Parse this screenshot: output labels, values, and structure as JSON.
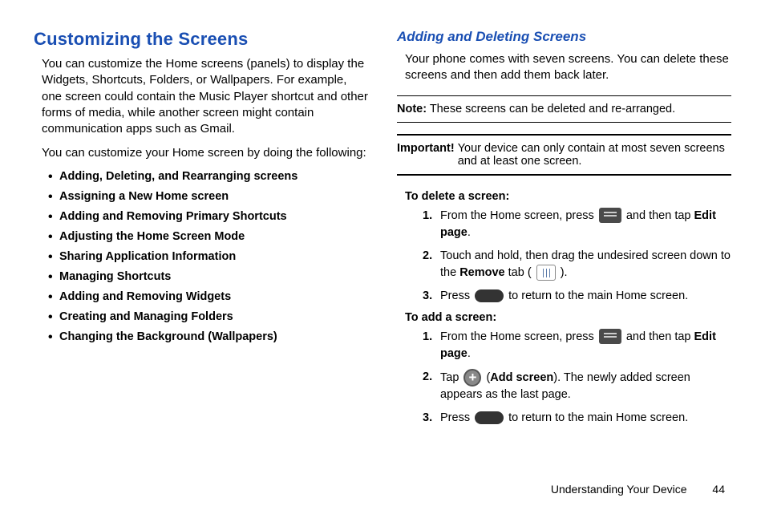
{
  "left": {
    "h1": "Customizing the Screens",
    "p1": "You can customize the Home screens (panels) to display the Widgets, Shortcuts, Folders, or Wallpapers. For example, one screen could contain the Music Player shortcut and other forms of media, while another screen might contain communication apps such as Gmail.",
    "p2": "You can customize your Home screen by doing the following:",
    "bullets": [
      "Adding, Deleting, and Rearranging screens",
      "Assigning a New Home screen",
      "Adding and Removing Primary Shortcuts",
      "Adjusting the Home Screen Mode",
      "Sharing Application Information",
      "Managing Shortcuts",
      "Adding and Removing Widgets",
      "Creating and Managing Folders",
      "Changing the Background (Wallpapers)"
    ]
  },
  "right": {
    "h2": "Adding and Deleting Screens",
    "p1": "Your phone comes with seven screens. You can delete these screens and then add them back later.",
    "note_label": "Note:",
    "note_text": " These screens can be deleted and re-arranged.",
    "important_label": "Important!",
    "important_text": " Your device can only contain at most seven screens and at least one screen.",
    "delete_h": "To delete a screen:",
    "delete_steps": {
      "s1a": "From the Home screen, press ",
      "s1b": " and then tap ",
      "s1c": "Edit page",
      "s1d": ".",
      "s2a": "Touch and hold, then drag the undesired screen down to the ",
      "s2b": "Remove",
      "s2c": " tab ( ",
      "s2d": " ).",
      "s3a": "Press ",
      "s3b": " to return to the main Home screen."
    },
    "add_h": "To add a screen:",
    "add_steps": {
      "s1a": "From the Home screen, press ",
      "s1b": " and then tap ",
      "s1c": "Edit page",
      "s1d": ".",
      "s2a": "Tap ",
      "s2b": " (",
      "s2c": "Add screen",
      "s2d": "). The newly added screen appears as the last page.",
      "s3a": "Press ",
      "s3b": " to return to the main Home screen."
    }
  },
  "footer": {
    "section": "Understanding Your Device",
    "page": "44"
  }
}
